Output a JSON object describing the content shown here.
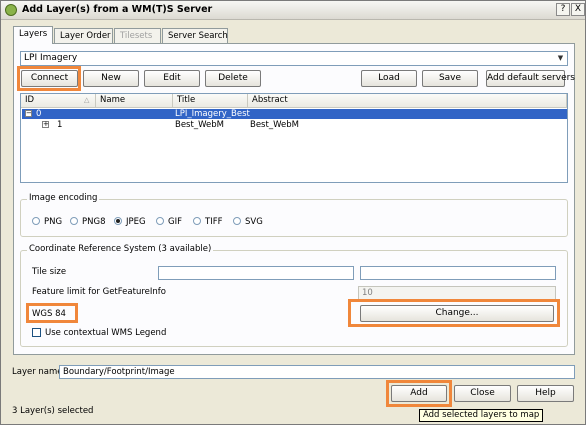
{
  "window": {
    "title": "Add Layer(s) from a WM(T)S Server",
    "help_btn": "?",
    "close_btn": "X"
  },
  "tabs": [
    {
      "label": "Layers",
      "active": true
    },
    {
      "label": "Layer Order",
      "active": false
    },
    {
      "label": "Tilesets",
      "active": false,
      "disabled": true
    },
    {
      "label": "Server Search",
      "active": false
    }
  ],
  "connection": {
    "selected": "LPI Imagery"
  },
  "buttons": {
    "connect": "Connect",
    "new": "New",
    "edit": "Edit",
    "delete": "Delete",
    "load": "Load",
    "save": "Save",
    "add_default": "Add default servers",
    "add": "Add",
    "close": "Close",
    "help": "Help",
    "change": "Change..."
  },
  "table": {
    "headers": [
      "ID",
      "Name",
      "Title",
      "Abstract"
    ],
    "rows": [
      {
        "expander": "−",
        "id": "0",
        "name": "",
        "title": "LPI_Imagery_Best",
        "abstract": "",
        "selected": true
      },
      {
        "expander": "+",
        "id": "1",
        "name": "",
        "title": "Best_WebM",
        "abstract": "Best_WebM",
        "selected": false
      }
    ]
  },
  "encoding": {
    "label": "Image encoding",
    "options": [
      "PNG",
      "PNG8",
      "JPEG",
      "GIF",
      "TIFF",
      "SVG"
    ],
    "selected": "JPEG"
  },
  "crs": {
    "label": "Coordinate Reference System (3 available)",
    "tile_size_label": "Tile size",
    "tile_width": "",
    "tile_height": "",
    "feature_limit_label": "Feature limit for GetFeatureInfo",
    "feature_limit": "10",
    "current": "WGS 84",
    "contextual_legend": "Use contextual WMS Legend"
  },
  "layer_name": {
    "label": "Layer name",
    "value": "Boundary/Footprint/Image"
  },
  "status": "3 Layer(s) selected",
  "tooltip": "Add selected layers to map",
  "accent_color": "#f0873b",
  "selection_color": "#3164c6"
}
